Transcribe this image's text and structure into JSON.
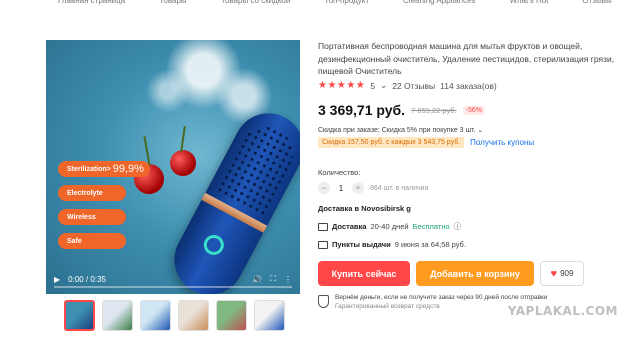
{
  "top_nav": {
    "items": [
      "Главная страница",
      "Товары",
      "Товары со скидкой",
      "Топ-продукт",
      "Cleaning Appliances",
      "What's Hot",
      "Отзывы"
    ]
  },
  "video": {
    "time": "0:00 / 0:35",
    "progress": 0.0,
    "features": [
      {
        "label": "Sterilization>",
        "value": "99,9%"
      },
      {
        "label": "Electrolyte"
      },
      {
        "label": "Wireless"
      },
      {
        "label": "Safe"
      }
    ],
    "controls": {
      "play_icon": "▶",
      "volume_icon": "🔊",
      "fullscreen_icon": "⛶",
      "more_icon": "⋮"
    }
  },
  "thumbnails": [
    {
      "colors": [
        "#3e8fb0",
        "#173f7f"
      ]
    },
    {
      "colors": [
        "#dfe8f0",
        "#3b7d4a"
      ]
    },
    {
      "colors": [
        "#cfe7f2",
        "#1f56b8"
      ]
    },
    {
      "colors": [
        "#e9e1d6",
        "#c98e5b"
      ]
    },
    {
      "colors": [
        "#7fb97f",
        "#c05050"
      ]
    },
    {
      "colors": [
        "#f2f2f2",
        "#1f56b8"
      ]
    }
  ],
  "product": {
    "title": "Портативная беспроводная машина для мытья фруктов и овощей, дезинфекционный очиститель, Удаление пестицидов, стерилизация грязи, пищевой Очиститель",
    "stars": "★★★★★",
    "rating": "5",
    "reviews": "22 Отзывы",
    "orders": "114 заказа(ов)",
    "price": "3 369,71 руб.",
    "old_price": "7 659,22 руб.",
    "discount": "-56%",
    "promo": "Скидка при заказе: Скидка 5% при покупке 3 шт.",
    "coupon": "Скидка 157,50 руб. с каждых 3 543,75 руб.",
    "coupon_link": "Получить купоны",
    "qty_label": "Количество:",
    "qty": "1",
    "stock": "864 шт. в наличии",
    "deliver_to": "Доставка в Novosibirsk g",
    "delivery_label": "Доставка",
    "delivery_time": "20-40 дней",
    "delivery_free": "Бесплатно",
    "pickup_label": "Пункты выдачи",
    "pickup_info": "9 июня за 64,58 руб.",
    "buy_label": "Купить сейчас",
    "cart_label": "Добавить в корзину",
    "wish_count": "909",
    "guarantee_title": "Вернём деньги, если не получите заказ через 90 дней после отправки",
    "guarantee_sub": "Гарантированный возврат средств"
  },
  "watermark": "YAPLAKAL.COM",
  "colors": {
    "accent": "#ff4747",
    "orange": "#ff9b1f",
    "coupon": "#d96b00",
    "link": "#1a73e8"
  }
}
